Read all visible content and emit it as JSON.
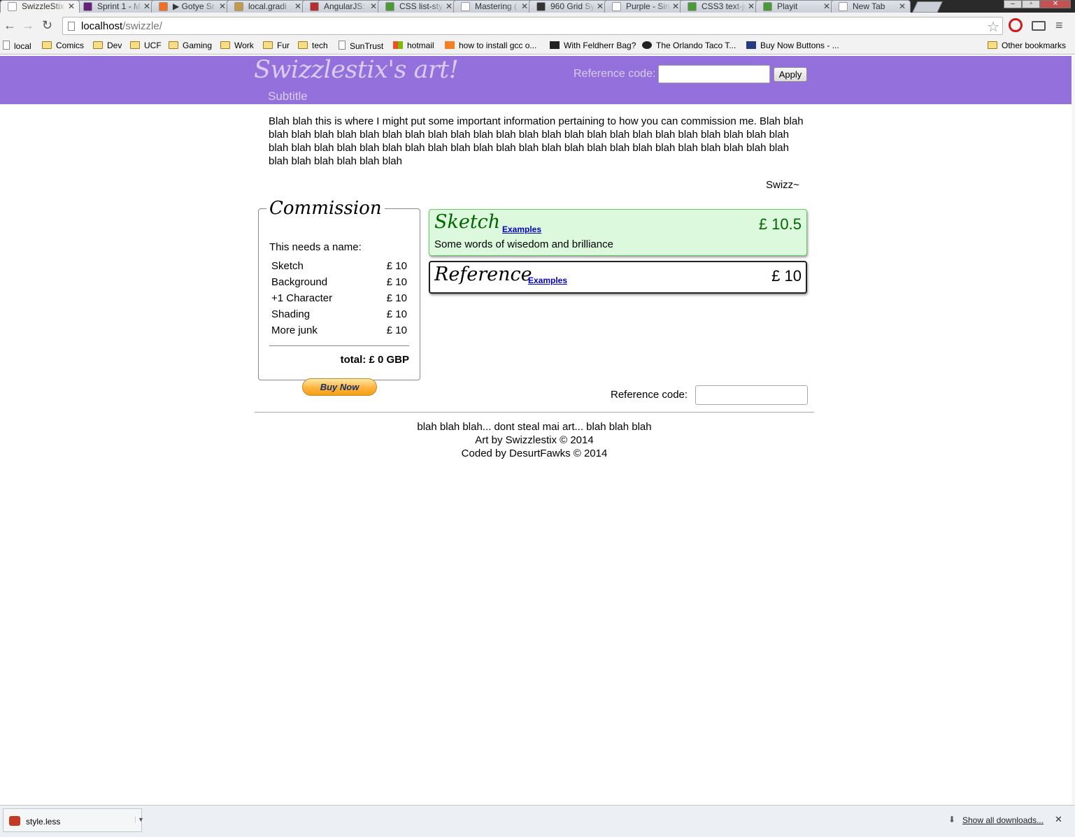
{
  "browser": {
    "tabs": [
      {
        "label": "SwizzleStix",
        "active": true,
        "color": "#ffffff"
      },
      {
        "label": "Sprint 1 - M",
        "active": false,
        "color": "#68217a"
      },
      {
        "label": "▶ Gotye Sr",
        "active": false,
        "color": "#f26f23"
      },
      {
        "label": "local.gradi",
        "active": false,
        "color": "#c29a4a"
      },
      {
        "label": "AngularJS: a",
        "active": false,
        "color": "#b52e31"
      },
      {
        "label": "CSS list-sty",
        "active": false,
        "color": "#4a9a3a"
      },
      {
        "label": "Mastering (",
        "active": false,
        "color": "#ffffff"
      },
      {
        "label": "960 Grid Sy",
        "active": false,
        "color": "#333333"
      },
      {
        "label": "Purple - Sin",
        "active": false,
        "color": "#ffffff"
      },
      {
        "label": "CSS3 text-ju",
        "active": false,
        "color": "#4a9a3a"
      },
      {
        "label": "Playit",
        "active": false,
        "color": "#4a9a3a"
      },
      {
        "label": "New Tab",
        "active": false,
        "color": "#ffffff"
      }
    ],
    "url_host": "localhost",
    "url_path": "/swizzle/",
    "bookmarks": [
      {
        "label": "local",
        "icon": "page"
      },
      {
        "label": "Comics",
        "icon": "folder"
      },
      {
        "label": "Dev",
        "icon": "folder"
      },
      {
        "label": "UCF",
        "icon": "folder"
      },
      {
        "label": "Gaming",
        "icon": "folder"
      },
      {
        "label": "Work",
        "icon": "folder"
      },
      {
        "label": "Fur",
        "icon": "folder"
      },
      {
        "label": "tech",
        "icon": "folder"
      },
      {
        "label": "SunTrust",
        "icon": "page"
      },
      {
        "label": "hotmail",
        "icon": "windows"
      },
      {
        "label": "how to install gcc o...",
        "icon": "stackoverflow"
      },
      {
        "label": "With Feldherr Bag?",
        "icon": "tumblr"
      },
      {
        "label": "The Orlando Taco T...",
        "icon": "paw"
      },
      {
        "label": "Buy Now Buttons - ...",
        "icon": "paypal"
      }
    ],
    "other_bookmarks": "Other bookmarks"
  },
  "header": {
    "title": "Swizzlestix's art!",
    "subtitle": "Subtitle",
    "reference_label": "Reference code:",
    "apply_label": "Apply",
    "bg_color": "#9370db"
  },
  "intro": {
    "text": "Blah blah this is where I might put some important information pertaining to how you can commission me. Blah blah blah blah blah blah blah blah blah blah blah blah blah blah blah blah blah blah blah blah blah blah blah blah blah blah blah blah blah blah blah blah blah blah blah blah blah blah blah blah blah blah blah blah blah blah blah blah blah blah blah blah blah blah",
    "signature": "Swizz~"
  },
  "commission": {
    "legend": "Commission",
    "name_label": "This needs a name:",
    "items": [
      {
        "name": "Sketch",
        "price": "£ 10"
      },
      {
        "name": "Background",
        "price": "£ 10"
      },
      {
        "name": "+1 Character",
        "price": "£ 10"
      },
      {
        "name": "Shading",
        "price": "£ 10"
      },
      {
        "name": "More junk",
        "price": "£ 10"
      }
    ],
    "total": "total: £ 0 GBP",
    "buy_label": "Buy Now"
  },
  "options": {
    "sketch": {
      "title": "Sketch",
      "examples": "Examples",
      "price": "£ 10.5",
      "description": "Some words of wisedom and brilliance",
      "color": "#006600"
    },
    "reference": {
      "title": "Reference",
      "examples": "Examples",
      "price": "£ 10"
    }
  },
  "reference_form": {
    "label": "Reference code:"
  },
  "footer": {
    "line1": "blah blah blah... dont steal mai art... blah blah blah",
    "line2": "Art by Swizzlestix © 2014",
    "line3": "Coded by DesurtFawks © 2014"
  },
  "downloads": {
    "file": "style.less",
    "show_all": "Show all downloads..."
  }
}
